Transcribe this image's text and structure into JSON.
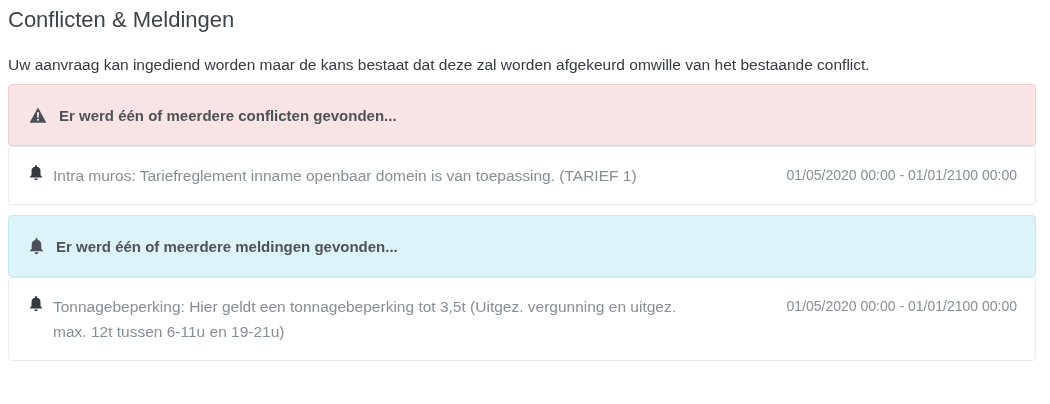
{
  "title": "Conflicten & Meldingen",
  "intro": "Uw aanvraag kan ingediend worden maar de kans bestaat dat deze zal worden afgekeurd omwille van het bestaande conflict.",
  "sections": [
    {
      "kind": "danger",
      "header": "Er werd één of meerdere conflicten gevonden...",
      "items": [
        {
          "text": "Intra muros: Tariefreglement inname openbaar domein is van toepassing. (TARIEF 1)",
          "period": "01/05/2020 00:00 - 01/01/2100 00:00"
        }
      ]
    },
    {
      "kind": "info",
      "header": "Er werd één of meerdere meldingen gevonden...",
      "items": [
        {
          "text": "Tonnagebeperking: Hier geldt een tonnagebeperking tot 3,5t (Uitgez. vergunning en uitgez. max. 12t tussen 6-11u en 19-21u)",
          "period": "01/05/2020 00:00 - 01/01/2100 00:00"
        }
      ]
    }
  ]
}
